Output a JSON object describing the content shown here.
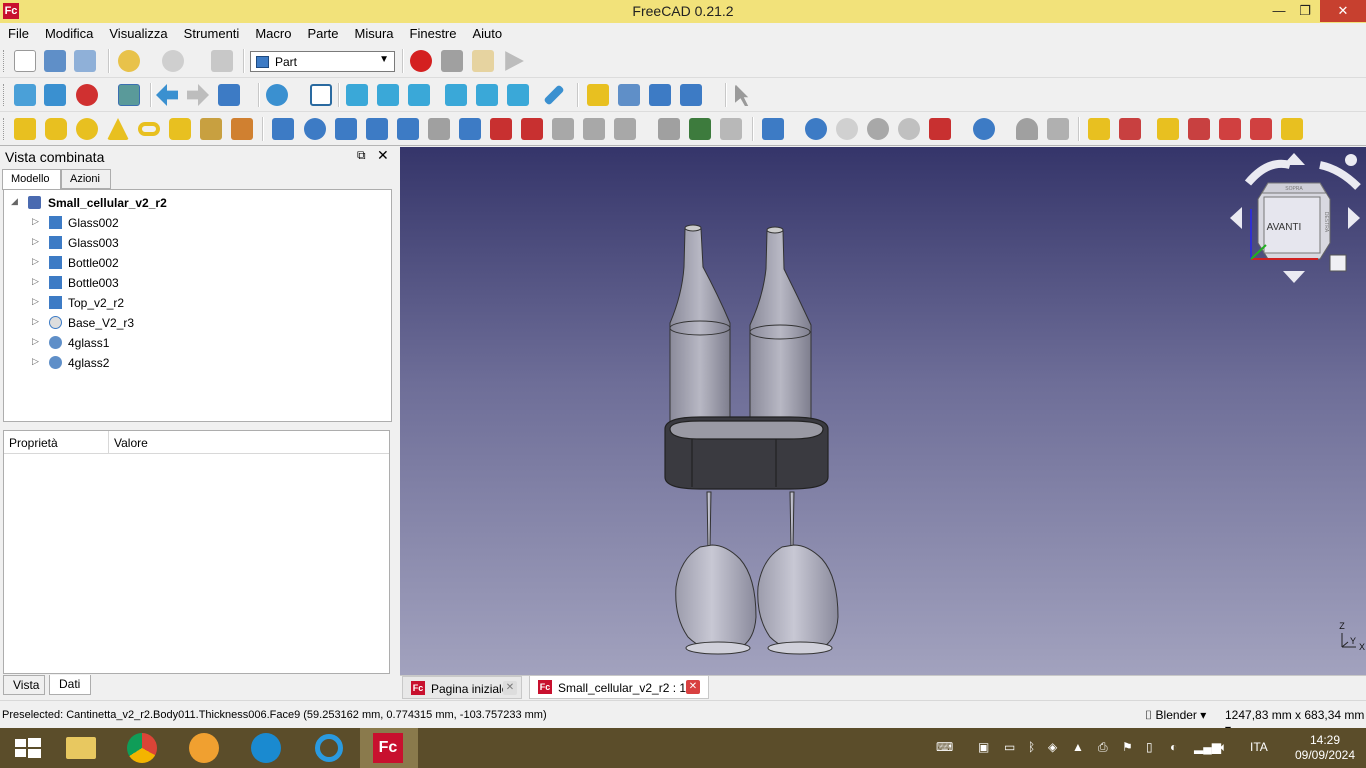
{
  "window": {
    "title": "FreeCAD 0.21.2",
    "minimize": "—",
    "maximize": "❐",
    "close": "✕"
  },
  "menu": [
    "File",
    "Modifica",
    "Visualizza",
    "Strumenti",
    "Macro",
    "Parte",
    "Misura",
    "Finestre",
    "Aiuto"
  ],
  "workbench": {
    "selected": "Part"
  },
  "combo_view": {
    "title": "Vista combinata",
    "tabs": [
      "Modello",
      "Azioni"
    ],
    "tree": {
      "root": "Small_cellular_v2_r2",
      "items": [
        "Glass002",
        "Glass003",
        "Bottle002",
        "Bottle003",
        "Top_v2_r2",
        "Base_V2_r3",
        "4glass1",
        "4glass2"
      ]
    },
    "properties": {
      "col1": "Proprietà",
      "col2": "Valore"
    },
    "bottom_tabs": [
      "Vista",
      "Dati"
    ]
  },
  "navcube": {
    "front_label": "AVANTI",
    "top_label": "SOPRA",
    "right_label": "DESTRA"
  },
  "axis": {
    "z": "Z",
    "y": "Y",
    "x": "X"
  },
  "doc_tabs": [
    {
      "label": "Pagina iniziale",
      "active": false
    },
    {
      "label": "Small_cellular_v2_r2 : 1*",
      "active": true
    }
  ],
  "status": {
    "message": "Preselected: Cantinetta_v2_r2.Body011.Thickness006.Face9 (59.253162 mm, 0.774315 mm, -103.757233 mm)",
    "nav_style": "Blender",
    "dimensions": "1247,83 mm x 683,34 mm"
  },
  "taskbar": {
    "lang": "ITA",
    "time": "14:29",
    "date": "09/09/2024"
  },
  "colors": {
    "titlebar": "#f2e27a",
    "taskbar": "#5b4d2a",
    "view_top": "#35356a",
    "view_bottom": "#a2a2be",
    "record": "#d42020"
  }
}
